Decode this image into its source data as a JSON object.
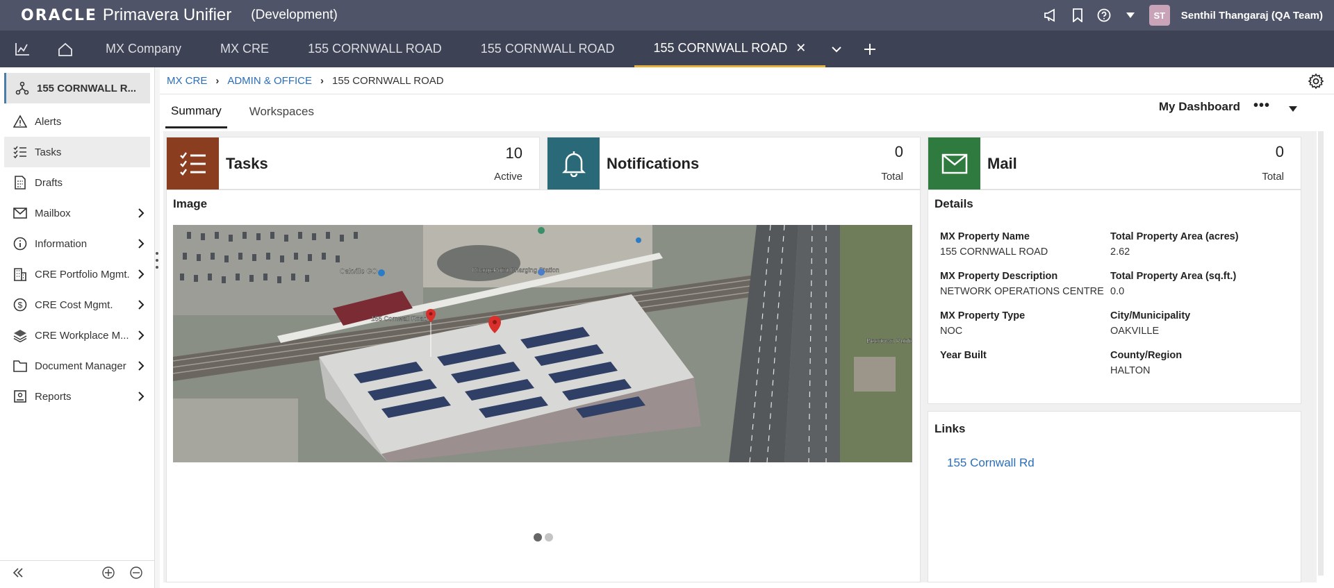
{
  "header": {
    "brand_oracle": "ORACLE",
    "brand_product": "Primavera Unifier",
    "environment": "(Development)",
    "user_initials": "ST",
    "user_name": "Senthil Thangaraj (QA Team)"
  },
  "tabs": [
    {
      "label": "MX Company"
    },
    {
      "label": "MX CRE"
    },
    {
      "label": "155 CORNWALL ROAD"
    },
    {
      "label": "155 CORNWALL ROAD"
    },
    {
      "label": "155 CORNWALL ROAD",
      "active": true
    }
  ],
  "sidebar": {
    "items": [
      {
        "label": "155 CORNWALL R...",
        "icon": "hierarchy-icon"
      },
      {
        "label": "Alerts",
        "icon": "warning-icon"
      },
      {
        "label": "Tasks",
        "icon": "tasks-icon"
      },
      {
        "label": "Drafts",
        "icon": "drafts-icon"
      },
      {
        "label": "Mailbox",
        "icon": "mail-icon"
      },
      {
        "label": "Information",
        "icon": "info-icon"
      },
      {
        "label": "CRE Portfolio Mgmt.",
        "icon": "building-icon"
      },
      {
        "label": "CRE Cost Mgmt.",
        "icon": "dollar-icon"
      },
      {
        "label": "CRE Workplace M...",
        "icon": "layers-icon"
      },
      {
        "label": "Document Manager",
        "icon": "folder-icon"
      },
      {
        "label": "Reports",
        "icon": "report-icon"
      }
    ]
  },
  "breadcrumb": {
    "items": [
      "MX CRE",
      "ADMIN & OFFICE"
    ],
    "current": "155 CORNWALL ROAD"
  },
  "subtabs": [
    {
      "label": "Summary",
      "active": true
    },
    {
      "label": "Workspaces"
    }
  ],
  "dashboard": {
    "title": "My Dashboard",
    "more": "•••"
  },
  "kpis": {
    "tasks": {
      "title": "Tasks",
      "value": "10",
      "sub": "Active",
      "color": "#8b3d1f"
    },
    "notifications": {
      "title": "Notifications",
      "value": "0",
      "sub": "Total",
      "color": "#2a6a78"
    },
    "mail": {
      "title": "Mail",
      "value": "0",
      "sub": "Total",
      "color": "#2f7a3f"
    }
  },
  "image_panel": {
    "title": "Image",
    "map_labels": {
      "station": "Oakville GO",
      "charge": "ChargePoint Charging Station",
      "address": "155 Cornwall Road",
      "beertown": "Beertown Public House O"
    }
  },
  "details": {
    "title": "Details",
    "fields": [
      {
        "label": "MX Property Name",
        "value": "155 CORNWALL ROAD"
      },
      {
        "label": "Total Property Area (acres)",
        "value": "2.62"
      },
      {
        "label": "MX Property Description",
        "value": "NETWORK OPERATIONS CENTRE"
      },
      {
        "label": "Total Property Area (sq.ft.)",
        "value": "0.0"
      },
      {
        "label": "MX Property Type",
        "value": "NOC"
      },
      {
        "label": "City/Municipality",
        "value": "OAKVILLE"
      },
      {
        "label": "Year Built",
        "value": ""
      },
      {
        "label": "County/Region",
        "value": "HALTON"
      }
    ]
  },
  "links": {
    "title": "Links",
    "items": [
      "155 Cornwall Rd"
    ]
  }
}
